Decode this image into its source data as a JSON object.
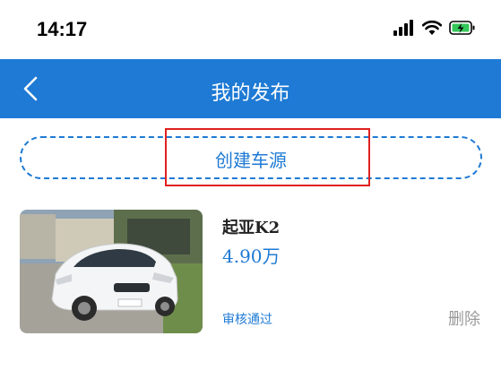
{
  "status_bar": {
    "time": "14:17"
  },
  "nav": {
    "title": "我的发布"
  },
  "create": {
    "label": "创建车源"
  },
  "listings": [
    {
      "title": "起亚K2",
      "price": "4.90万",
      "status": "审核通过",
      "delete_label": "删除"
    }
  ],
  "colors": {
    "accent": "#1e7ad4",
    "highlight": "#e02020",
    "muted": "#999999"
  },
  "icons": [
    "signal-icon",
    "wifi-icon",
    "battery-icon",
    "back-arrow-icon",
    "car-photo"
  ]
}
